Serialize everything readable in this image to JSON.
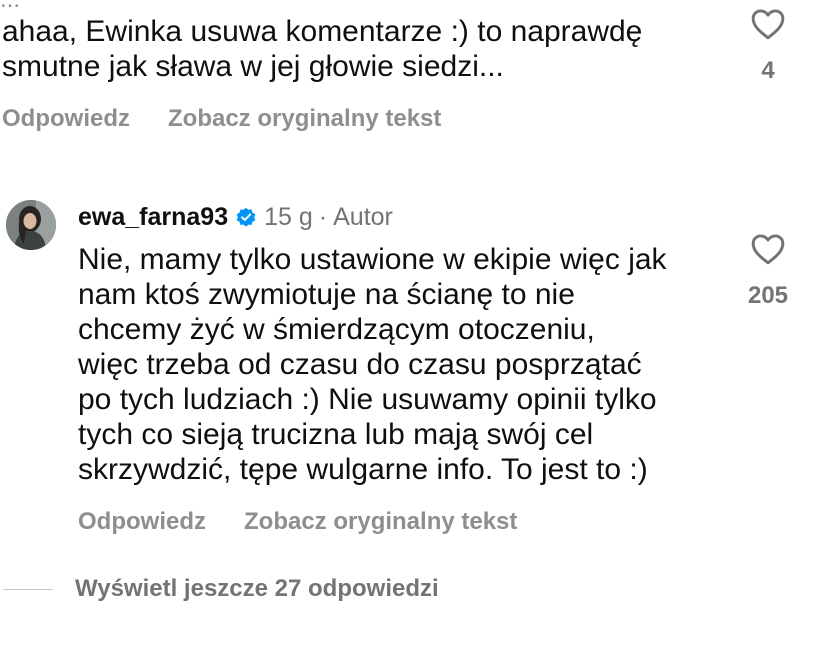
{
  "top_cut_text": "...",
  "comment_1": {
    "text": "ahaa, Ewinka usuwa komentarze :) to naprawdę\nsmutne jak sława w jej głowie siedzi...",
    "like_count": "4",
    "reply_label": "Odpowiedz",
    "see_original_label": "Zobacz oryginalny tekst",
    "icons": {
      "like": "heart-outline-icon"
    }
  },
  "comment_2": {
    "username": "ewa_farna93",
    "time": "15 g",
    "separator": "·",
    "author_badge": "Autor",
    "text": "Nie, mamy tylko ustawione w ekipie więc jak\nnam ktoś zwymiotuje na ścianę to nie\nchcemy żyć w śmierdzącym otoczeniu,\nwięc trzeba od czasu do czasu posprzątać\npo tych ludziach :) Nie usuwamy opinii tylko\ntych co sieją trucizna lub mają swój cel\nskrzywdzić, tępe wulgarne info. To jest to :)",
    "like_count": "205",
    "reply_label": "Odpowiedz",
    "see_original_label": "Zobacz oryginalny tekst",
    "icons": {
      "like": "heart-outline-icon",
      "verified": "verified-badge-icon",
      "avatar": "avatar"
    }
  },
  "view_replies_label": "Wyświetl jeszcze 27 odpowiedzi",
  "colors": {
    "text_primary": "#0f0f0f",
    "text_secondary": "#737373",
    "text_action": "#8e8e8e",
    "verified_blue": "#0095f6",
    "divider": "#c7c7c7",
    "background": "#ffffff"
  }
}
